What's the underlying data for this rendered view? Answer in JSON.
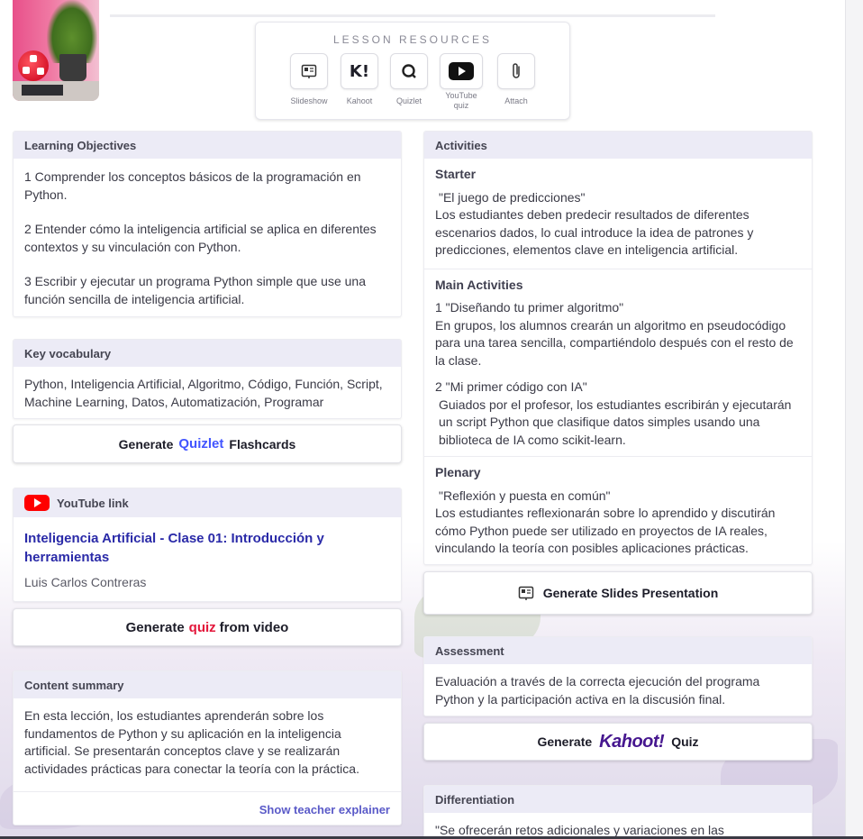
{
  "resources": {
    "title": "LESSON RESOURCES",
    "items": [
      {
        "label": "Slideshow",
        "icon": "slideshow-icon"
      },
      {
        "label": "Kahoot",
        "icon": "kahoot-icon"
      },
      {
        "label": "Quizlet",
        "icon": "quizlet-icon"
      },
      {
        "label": "YouTube quiz",
        "icon": "youtube-icon"
      },
      {
        "label": "Attach",
        "icon": "paperclip-icon"
      }
    ]
  },
  "objectives": {
    "title": "Learning Objectives",
    "items": [
      "1 Comprender los conceptos básicos de la programación en Python.",
      "2 Entender cómo la inteligencia artificial se aplica en diferentes contextos y su vinculación con Python.",
      "3 Escribir y ejecutar un programa Python simple que use una función sencilla de inteligencia artificial."
    ]
  },
  "vocabulary": {
    "title": "Key vocabulary",
    "text": "Python, Inteligencia Artificial, Algoritmo, Código, Función, Script, Machine Learning, Datos, Automatización, Programar"
  },
  "quizlet_button": {
    "prefix": "Generate",
    "brand": "Quizlet",
    "suffix": "Flashcards"
  },
  "youtube": {
    "title": "YouTube link",
    "video_title": "Inteligencia Artificial - Clase 01: Introducción y herramientas",
    "author": "Luis Carlos Contreras"
  },
  "quiz_video_button": {
    "prefix": "Generate",
    "highlight": "quiz",
    "suffix": "from video"
  },
  "summary": {
    "title": "Content summary",
    "text": "En esta lección, los estudiantes aprenderán sobre los fundamentos de Python y su aplicación en la inteligencia artificial. Se presentarán conceptos clave y se realizarán actividades prácticas para conectar la teoría con la práctica.",
    "link": "Show teacher explainer"
  },
  "activities": {
    "title": "Activities",
    "starter": {
      "heading": "Starter",
      "name": "\"El juego de predicciones\"",
      "text": "Los estudiantes deben predecir resultados de diferentes escenarios dados, lo cual introduce la idea de patrones y predicciones, elementos clave en inteligencia artificial."
    },
    "main": {
      "heading": "Main Activities",
      "items": [
        {
          "name": "1 \"Diseñando tu primer algoritmo\"",
          "text": "En grupos, los alumnos crearán un algoritmo en pseudocódigo para una tarea sencilla, compartiéndolo después con el resto de la clase."
        },
        {
          "name": "2 \"Mi primer código con IA\"",
          "text": "Guiados por el profesor, los estudiantes escribirán y ejecutarán un script Python que clasifique datos simples usando una biblioteca de IA como scikit-learn."
        }
      ]
    },
    "plenary": {
      "heading": "Plenary",
      "name": "\"Reflexión y puesta en común\"",
      "text": "Los estudiantes reflexionarán sobre lo aprendido y discutirán cómo Python puede ser utilizado en proyectos de IA reales, vinculando la teoría con posibles aplicaciones prácticas."
    }
  },
  "slides_button": {
    "label": "Generate Slides Presentation"
  },
  "assessment": {
    "title": "Assessment",
    "text": "Evaluación a través de la correcta ejecución del programa Python y la participación activa en la discusión final."
  },
  "kahoot_button": {
    "prefix": "Generate",
    "brand": "Kahoot!",
    "suffix": "Quiz"
  },
  "differentiation": {
    "title": "Differentiation",
    "text": "\"Se ofrecerán retos adicionales y variaciones en las"
  },
  "colors": {
    "accent": "#4255ff",
    "header_bg": "#ecebf6",
    "youtube_red": "#ff0000",
    "kahoot_purple": "#46178f",
    "quiz_red": "#e3163a"
  }
}
